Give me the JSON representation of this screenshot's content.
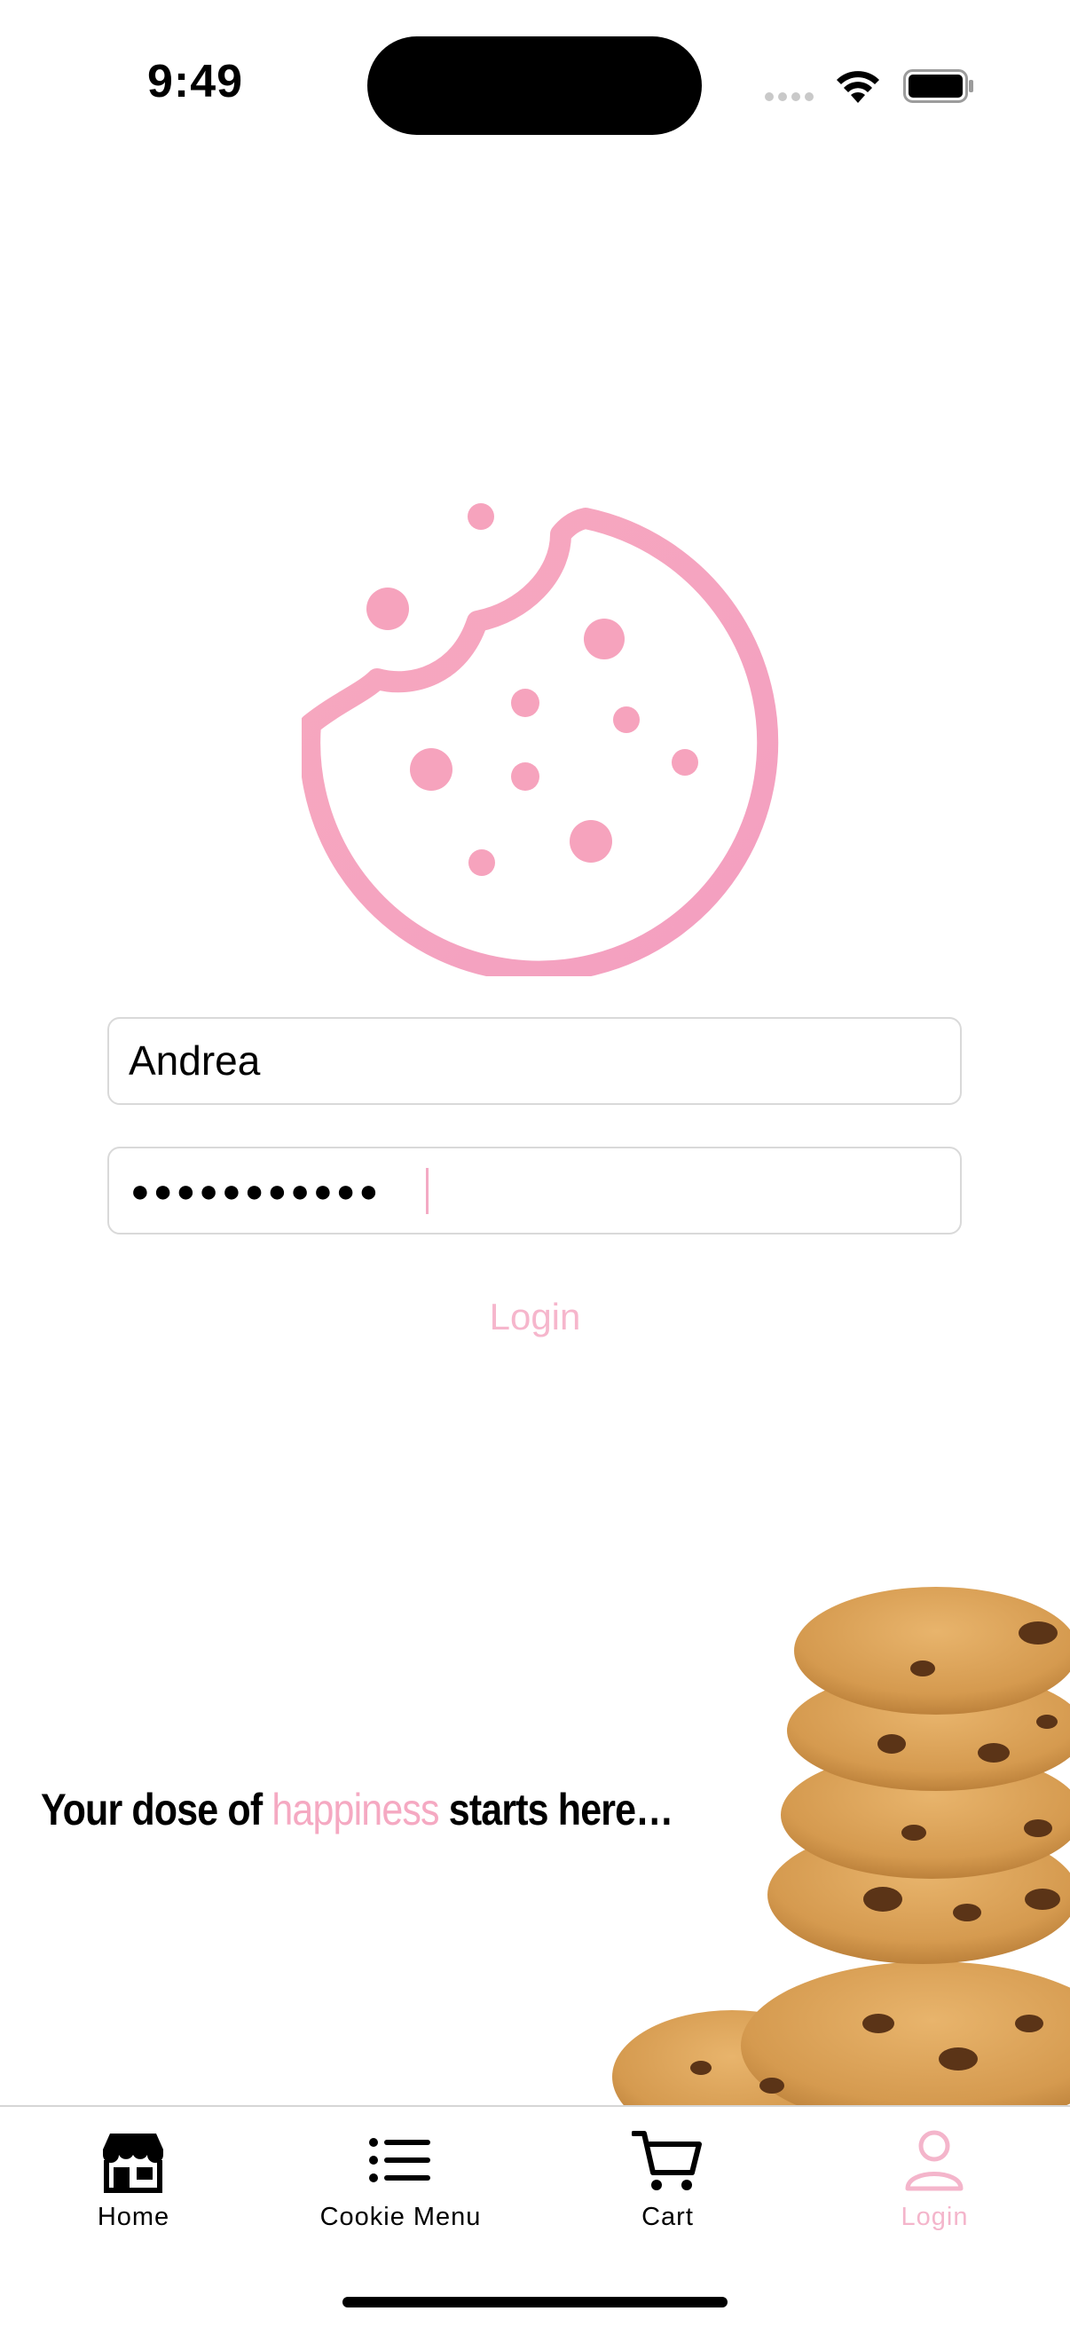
{
  "status_bar": {
    "time": "9:49"
  },
  "login_form": {
    "username_value": "Andrea",
    "password_masked": "●●●●●●●●●●●",
    "login_label": "Login"
  },
  "tagline": {
    "before": "Your dose of ",
    "highlight": "happiness",
    "after": " starts here…"
  },
  "tab_bar": {
    "items": [
      {
        "label": "Home",
        "icon": "storefront-icon"
      },
      {
        "label": "Cookie Menu",
        "icon": "list-icon"
      },
      {
        "label": "Cart",
        "icon": "cart-icon"
      },
      {
        "label": "Login",
        "icon": "person-icon"
      }
    ],
    "active_index": 3
  },
  "colors": {
    "accent_pink": "#f5a9c2",
    "logo_pink": "#f6a3bd"
  }
}
